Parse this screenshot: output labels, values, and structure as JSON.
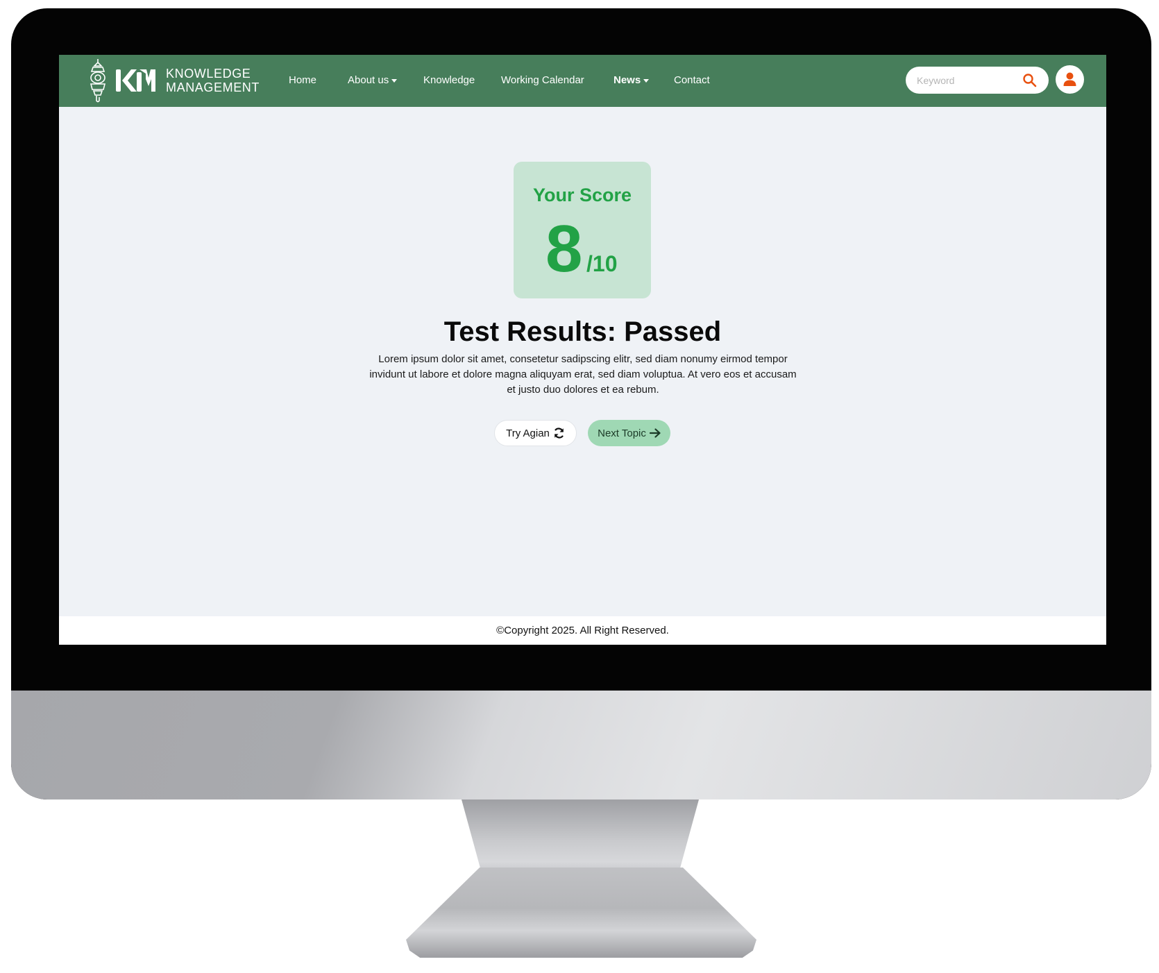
{
  "brand": {
    "line1": "KNOWLEDGE",
    "line2": "MANAGEMENT",
    "mark": "KM",
    "emblem_icon": "lantern-emblem-icon"
  },
  "nav": {
    "items": [
      {
        "label": "Home",
        "has_dropdown": false
      },
      {
        "label": "About us",
        "has_dropdown": true
      },
      {
        "label": "Knowledge",
        "has_dropdown": false
      },
      {
        "label": "Working Calendar",
        "has_dropdown": false
      },
      {
        "label": "News",
        "has_dropdown": true
      },
      {
        "label": "Contact",
        "has_dropdown": false
      }
    ]
  },
  "search": {
    "placeholder": "Keyword",
    "value": "",
    "icon": "search-icon"
  },
  "user": {
    "icon": "user-icon"
  },
  "score": {
    "label": "Your Score",
    "value": "8",
    "total": "/10"
  },
  "result": {
    "title": "Test Results: Passed",
    "description": "Lorem ipsum dolor sit amet, consetetur sadipscing elitr, sed diam nonumy eirmod tempor invidunt ut labore et dolore magna aliquyam erat, sed diam voluptua. At vero eos et accusam et justo duo dolores et ea rebum."
  },
  "actions": {
    "try_again": {
      "label": "Try Agian",
      "icon": "refresh-icon"
    },
    "next_topic": {
      "label": "Next Topic",
      "icon": "arrow-right-icon"
    }
  },
  "footer": {
    "copyright": "©Copyright 2025. All Right Reserved."
  },
  "colors": {
    "nav_bg": "#477e5b",
    "page_bg": "#eff2f6",
    "score_card_bg": "#c7e4d3",
    "score_text": "#22a246",
    "next_button_bg": "#9fd8b4",
    "accent_orange": "#e8500f"
  }
}
